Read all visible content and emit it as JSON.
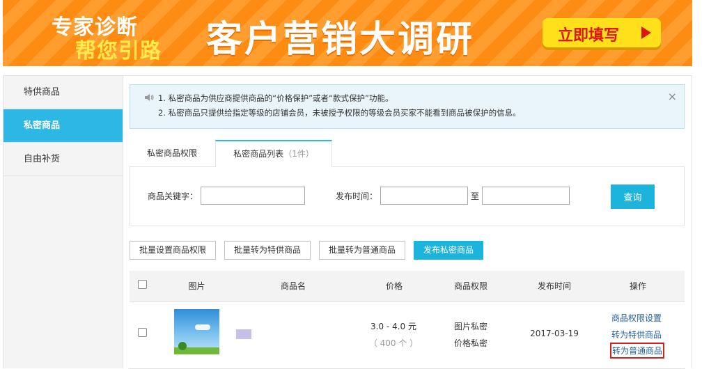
{
  "banner": {
    "tag_line1": "专家诊断",
    "tag_line2": "帮您引路",
    "headline": "客户营销大调研",
    "cta_label": "立即填写",
    "colors": {
      "background": "#ff8c12",
      "cta": "#ffe01a",
      "cta_text": "#e0150d"
    }
  },
  "sidebar": {
    "items": [
      {
        "label": "特供商品",
        "active": false
      },
      {
        "label": "私密商品",
        "active": true
      },
      {
        "label": "自由补货",
        "active": false
      }
    ]
  },
  "notice": {
    "icon": "speaker-icon",
    "line1": "1. 私密商品为供应商提供商品的“价格保护”或者“款式保护”功能。",
    "line2": "2. 私密商品只提供给指定等级的店铺会员，未被授予权限的等级会员买家不能看到商品被保护的信息。",
    "close_glyph": "×"
  },
  "tabs": [
    {
      "label": "私密商品权限"
    },
    {
      "label": "私密商品列表",
      "count": "（1件）",
      "active": true
    }
  ],
  "search": {
    "keyword_label": "商品关键字：",
    "keyword_value": "",
    "date_label": "发布时间：",
    "date_from": "",
    "date_sep": "至",
    "date_to": "",
    "query_label": "查询"
  },
  "actions": {
    "batch_permission": "批量设置商品权限",
    "batch_to_special": "批量转为特供商品",
    "batch_to_normal": "批量转为普通商品",
    "publish_private": "发布私密商品"
  },
  "table": {
    "headers": {
      "image": "图片",
      "name": "商品名",
      "price": "价格",
      "permission": "商品权限",
      "publish_time": "发布时间",
      "operation": "操作"
    },
    "rows": [
      {
        "name": "",
        "price": "3.0 - 4.0 元",
        "stock": "（ 400 个 ）",
        "permission1": "图片私密",
        "permission2": "价格私密",
        "publish_time": "2017-03-19",
        "op_permission": "商品权限设置",
        "op_to_special": "转为特供商品",
        "op_to_normal": "转为普通商品"
      }
    ]
  },
  "colors": {
    "accent": "#2db7e5",
    "link": "#1f5e9c",
    "highlight_border": "#d21f1f"
  }
}
